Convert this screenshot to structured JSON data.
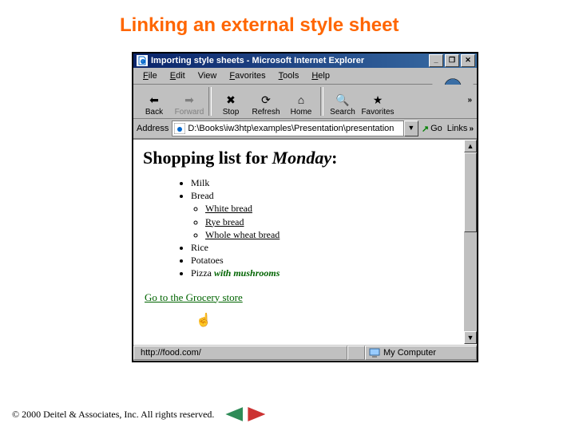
{
  "slide": {
    "title": "Linking an external style sheet"
  },
  "window": {
    "title": "Importing style sheets - Microsoft Internet Explorer",
    "controls": {
      "min": "_",
      "max": "❐",
      "close": "✕"
    }
  },
  "menu": {
    "file": "File",
    "edit": "Edit",
    "view": "View",
    "favorites": "Favorites",
    "tools": "Tools",
    "help": "Help"
  },
  "toolbar": {
    "back": "Back",
    "forward": "Forward",
    "stop": "Stop",
    "refresh": "Refresh",
    "home": "Home",
    "search": "Search",
    "favorites": "Favorites",
    "more": "»"
  },
  "address": {
    "label": "Address",
    "value": "D:\\Books\\iw3htp\\examples\\Presentation\\presentation",
    "go": "Go",
    "links": "Links",
    "links_more": "»"
  },
  "page": {
    "heading_prefix": "Shopping list for ",
    "heading_day": "Monday",
    "heading_suffix": ":",
    "items": [
      "Milk",
      "Bread",
      "Rice",
      "Potatoes"
    ],
    "bread_sub": [
      "White bread",
      "Rye bread",
      "Whole wheat bread"
    ],
    "pizza_prefix": "Pizza ",
    "pizza_emph": "with mushrooms",
    "link_text": "Go to the Grocery store"
  },
  "status": {
    "url": "http://food.com/",
    "zone": "My Computer"
  },
  "scrollbar": {
    "up": "▲",
    "down": "▼"
  },
  "footer": {
    "copyright": "© 2000 Deitel & Associates, Inc.  All rights reserved."
  }
}
